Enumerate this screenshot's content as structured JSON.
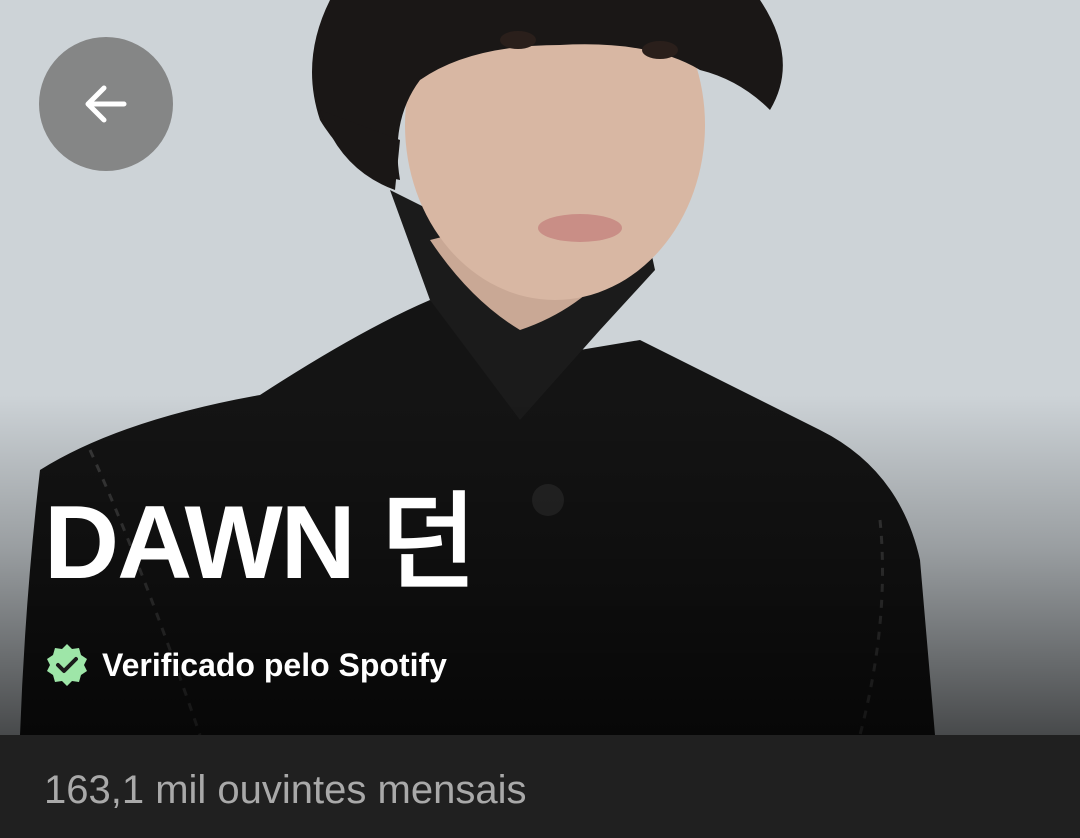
{
  "artist": {
    "name": "DAWN 던",
    "verified_label": "Verificado pelo Spotify",
    "monthly_listeners": "163,1 mil ouvintes mensais"
  },
  "icons": {
    "back": "arrow-left-icon",
    "verified": "verified-badge-icon"
  },
  "colors": {
    "verified_badge": "#9ee6a8",
    "listeners_bar": "#202020",
    "listeners_text": "#a9a9a9"
  }
}
